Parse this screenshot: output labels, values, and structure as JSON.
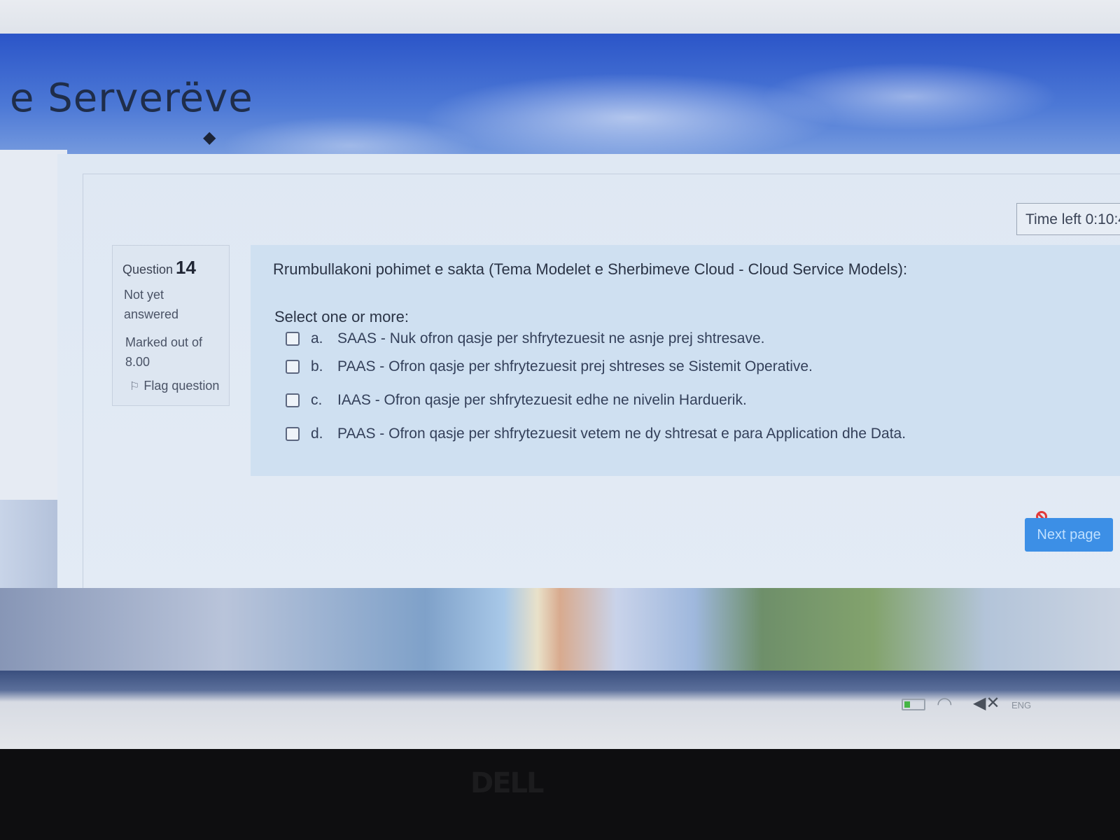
{
  "site": {
    "title": "e Serverëve"
  },
  "timer": {
    "label": "Time left 0:10:4"
  },
  "question_info": {
    "label": "Question",
    "number": "14",
    "state": "Not yet answered",
    "grade": "Marked out of 8.00",
    "flag_label": "Flag question"
  },
  "question": {
    "text": "Rrumbullakoni pohimet e sakta (Tema Modelet e Sherbimeve Cloud - Cloud Service Models):",
    "prompt": "Select one or more:",
    "answers": [
      {
        "letter": "a.",
        "text": "SAAS - Nuk ofron qasje per shfrytezuesit ne asnje prej shtresave."
      },
      {
        "letter": "b.",
        "text": "PAAS - Ofron qasje per shfrytezuesit prej shtreses se Sistemit Operative."
      },
      {
        "letter": "c.",
        "text": "IAAS - Ofron qasje per shfrytezuesit edhe ne nivelin Harduerik."
      },
      {
        "letter": "d.",
        "text": "PAAS - Ofron qasje per shfrytezuesit vetem ne dy shtresat e para Application dhe Data."
      }
    ]
  },
  "navigation": {
    "next_label": "Next page"
  },
  "taskbar": {
    "language": "ENG",
    "icons": [
      "battery-icon",
      "wifi-icon",
      "volume-muted-icon"
    ]
  },
  "bezel": {
    "logo": "DELL"
  }
}
